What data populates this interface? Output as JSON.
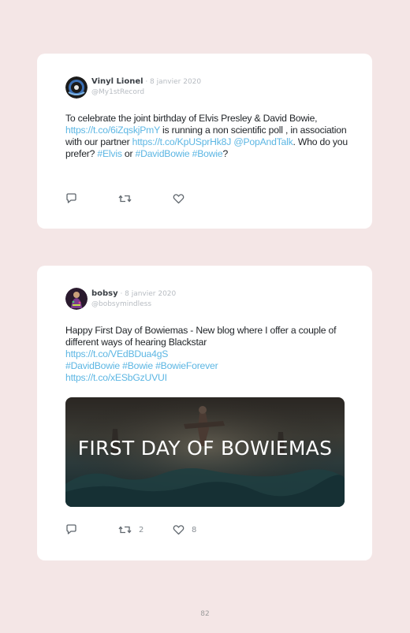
{
  "tweets": [
    {
      "name": "Vinyl Lionel",
      "separator": "·",
      "date": "8 janvier 2020",
      "handle": "@My1stRecord",
      "body": [
        {
          "t": "To celebrate the joint birthday of Elvis Presley & David Bowie, "
        },
        {
          "t": "https://t.co/6iZqskjPmY",
          "link": true
        },
        {
          "t": " is running a non scientific poll , in association with our partner "
        },
        {
          "t": "https://t.co/KpUSprHk8J",
          "link": true
        },
        {
          "t": " "
        },
        {
          "t": "@PopAndTalk",
          "link": true
        },
        {
          "t": ". Who do you prefer? "
        },
        {
          "t": "#Elvis",
          "link": true
        },
        {
          "t": " or "
        },
        {
          "t": "#DavidBowie",
          "link": true
        },
        {
          "t": " "
        },
        {
          "t": "#Bowie",
          "link": true
        },
        {
          "t": "?"
        }
      ],
      "icons": [
        "reply-icon",
        "retweet-icon",
        "like-icon"
      ],
      "retweets": "",
      "likes": ""
    },
    {
      "name": "bobsy",
      "separator": "·",
      "date": "8 janvier 2020",
      "handle": "@bobsymindless",
      "body_lines": [
        [
          {
            "t": "Happy First Day of Bowiemas - New blog where I offer a couple of different ways of hearing Blackstar"
          }
        ],
        [
          {
            "t": "https://t.co/VEdBDua4gS",
            "link": true
          }
        ],
        [
          {
            "t": "#DavidBowie",
            "link": true
          },
          {
            "t": " "
          },
          {
            "t": "#Bowie",
            "link": true
          },
          {
            "t": " "
          },
          {
            "t": "#BowieForever",
            "link": true
          }
        ],
        [
          {
            "t": "https://t.co/xESbGzUVUI",
            "link": true
          }
        ]
      ],
      "media_caption": "FIRST DAY OF BOWIEMAS",
      "icons": [
        "reply-icon",
        "retweet-icon",
        "like-icon"
      ],
      "retweets": "2",
      "likes": "8"
    }
  ],
  "page_number": "82"
}
